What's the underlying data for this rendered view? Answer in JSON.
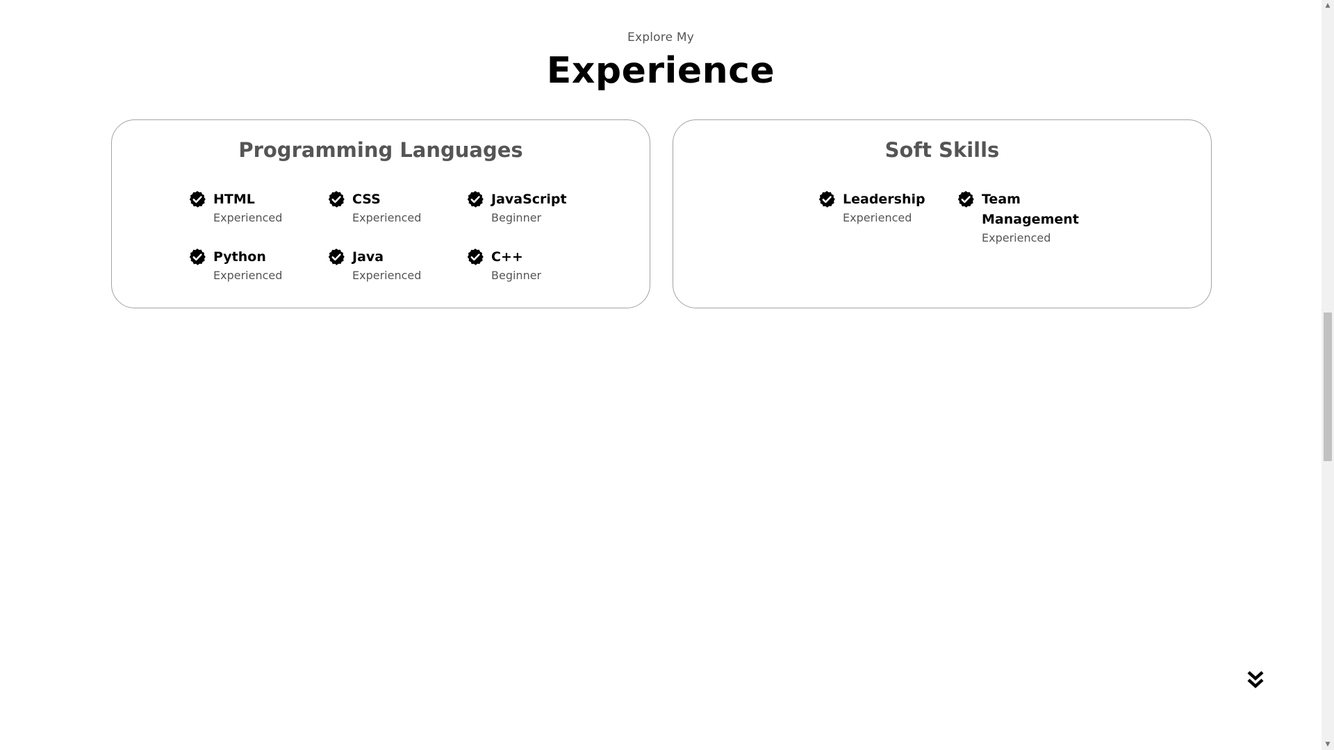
{
  "header": {
    "subtitle": "Explore My",
    "title": "Experience"
  },
  "cards": {
    "programming": {
      "title": "Programming Languages",
      "skills": [
        {
          "name": "HTML",
          "level": "Experienced"
        },
        {
          "name": "CSS",
          "level": "Experienced"
        },
        {
          "name": "JavaScript",
          "level": "Beginner"
        },
        {
          "name": "Python",
          "level": "Experienced"
        },
        {
          "name": "Java",
          "level": "Experienced"
        },
        {
          "name": "C++",
          "level": "Beginner"
        }
      ]
    },
    "soft": {
      "title": "Soft Skills",
      "skills": [
        {
          "name": "Leadership",
          "level": "Experienced"
        },
        {
          "name": "Team Management",
          "level": "Experienced"
        }
      ]
    }
  },
  "icons": {
    "skill": "checkmark-badge-icon",
    "scroll": "double-chevron-down-icon"
  },
  "colors": {
    "text": "#000000",
    "muted": "#555555",
    "border": "#a3a3a3"
  }
}
